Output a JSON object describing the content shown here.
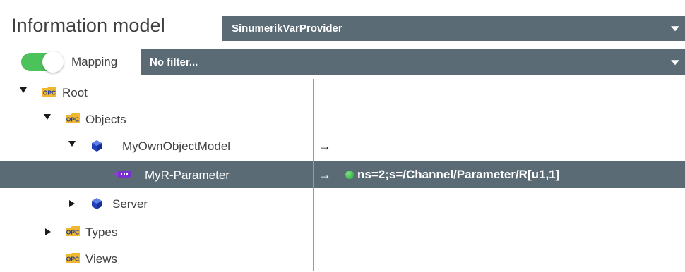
{
  "header": {
    "title": "Information model",
    "provider": "SinumerikVarProvider"
  },
  "mapping": {
    "toggle_on": true,
    "label": "Mapping",
    "filter": "No filter..."
  },
  "tree": {
    "rows": [
      {
        "label": "Root",
        "icon": "opc-folder-icon",
        "expander": "expanded"
      },
      {
        "label": "Objects",
        "icon": "opc-folder-icon",
        "expander": "expanded"
      },
      {
        "label": "MyOwnObjectModel",
        "icon": "object-cube-icon",
        "expander": "expanded",
        "mapping_arrow": "→"
      },
      {
        "label": "MyR-Parameter",
        "icon": "variable-icon",
        "selected": true,
        "mapping_arrow": "→",
        "mapping_status": "green",
        "mapping_value": "ns=2;s=/Channel/Parameter/R[u1,1]"
      },
      {
        "label": "Server",
        "icon": "object-cube-icon",
        "expander": "collapsed"
      },
      {
        "label": "Types",
        "icon": "opc-folder-icon",
        "expander": "collapsed"
      },
      {
        "label": "Views",
        "icon": "opc-folder-icon"
      }
    ]
  },
  "colors": {
    "select_bg": "#5b6b76",
    "toggle_on": "#4cc25a",
    "status_ok": "#22a83a"
  }
}
